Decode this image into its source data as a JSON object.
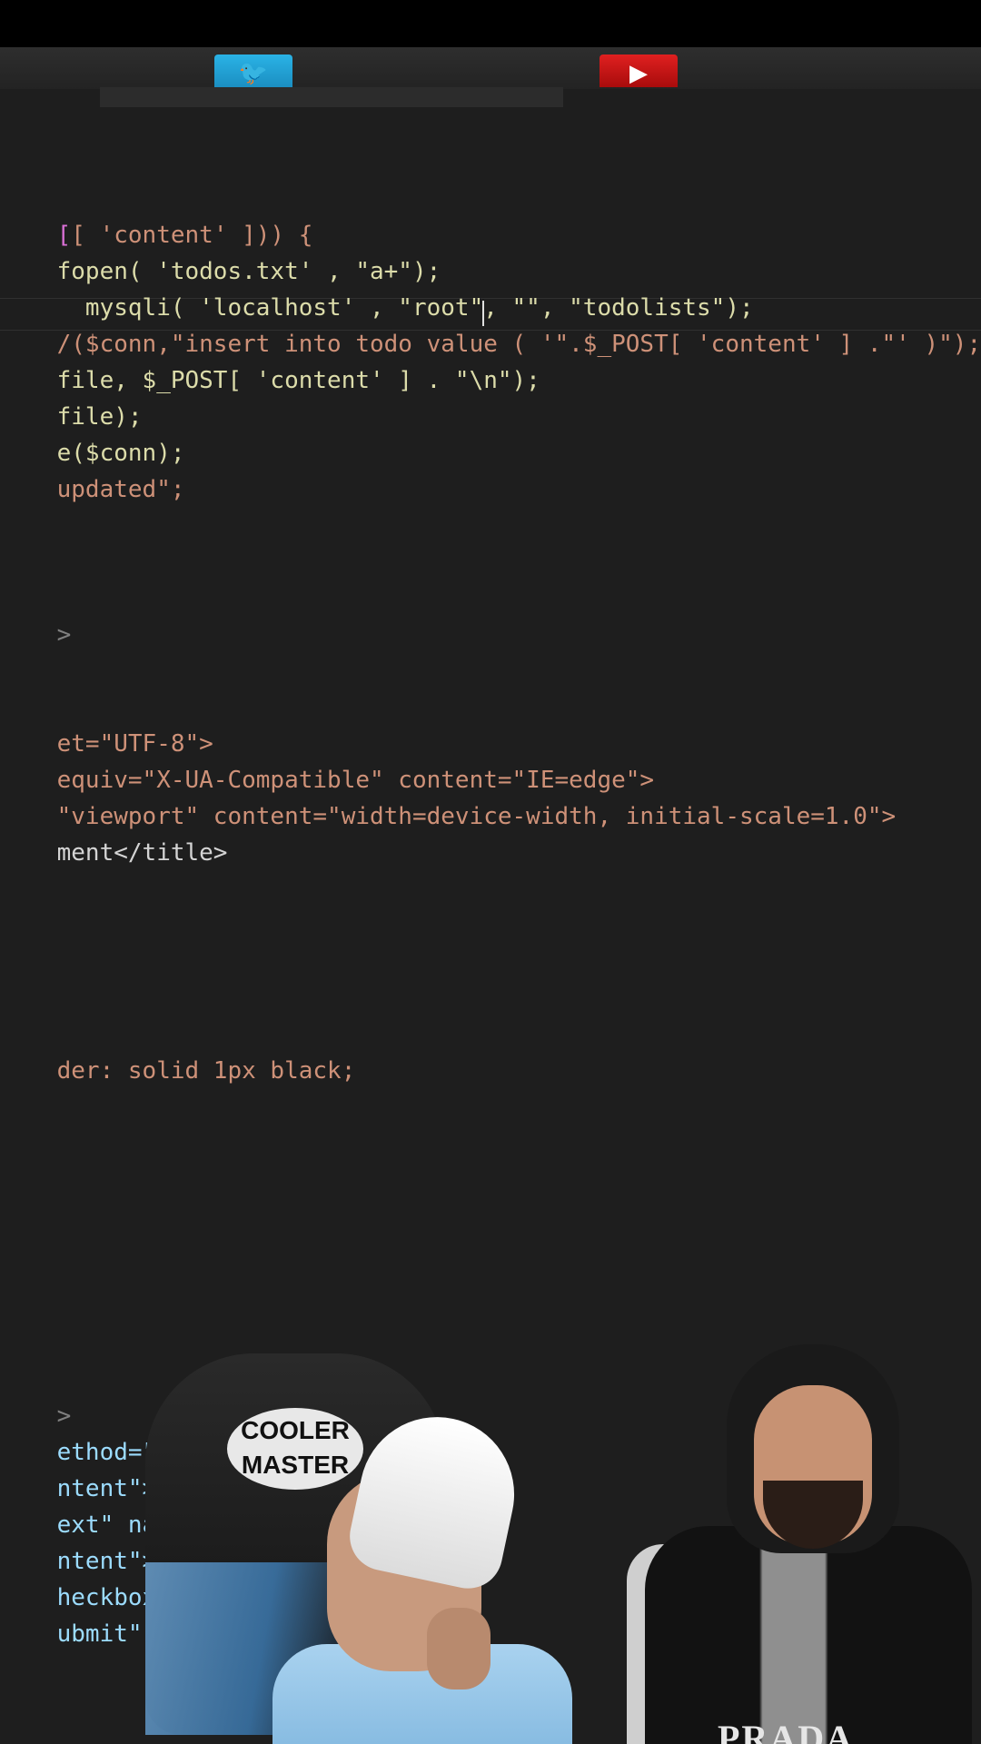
{
  "window": {
    "social_buttons": [
      {
        "name": "twitter",
        "icon": "twitter-icon",
        "color": "#1da1f2"
      },
      {
        "name": "youtube",
        "icon": "youtube-icon",
        "color": "#e02020"
      }
    ]
  },
  "editor": {
    "lines": [
      "[ 'content' ])) {",
      "fopen( 'todos.txt' , \"a+\");",
      "  mysqli( 'localhost' , \"root\", \"\", \"todolists\");",
      "/($conn,\"insert into todo value ( '\".$_POST[ 'content' ] .\"' )\");",
      "file, $_POST[ 'content' ] . \"\\n\");",
      "file);",
      "e($conn);",
      "updated\";",
      ">",
      "et=\"UTF-8\">",
      "equiv=\"X-UA-Compatible\" content=\"IE=edge\">",
      "\"viewport\" content=\"width=device-width, initial-scale=1.0\">",
      "ment</title>",
      "der: solid 1px black;",
      ">",
      "ethod=\"po",
      "ntent\">Co",
      "ext\" name",
      "ntent\">St",
      "heckbox\"",
      "ubmit\" va"
    ]
  },
  "webcam": {
    "chair_logo": "COOLER MASTER",
    "shirt_brand": "PRADA"
  }
}
